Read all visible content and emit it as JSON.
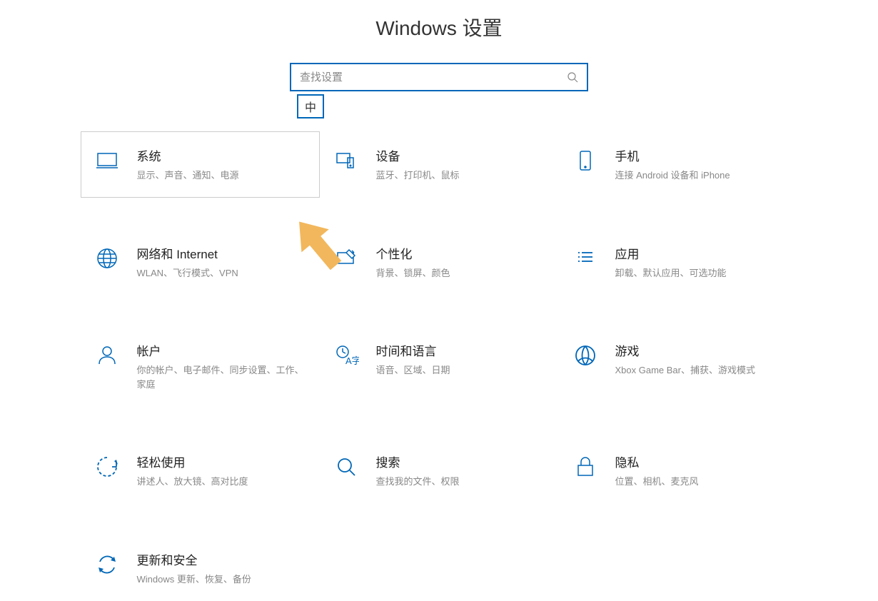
{
  "header": {
    "title": "Windows 设置"
  },
  "search": {
    "placeholder": "查找设置"
  },
  "ime": {
    "label": "中"
  },
  "settings": [
    {
      "id": "system",
      "title": "系统",
      "desc": "显示、声音、通知、电源",
      "highlighted": true
    },
    {
      "id": "devices",
      "title": "设备",
      "desc": "蓝牙、打印机、鼠标",
      "highlighted": false
    },
    {
      "id": "phone",
      "title": "手机",
      "desc": "连接 Android 设备和 iPhone",
      "highlighted": false
    },
    {
      "id": "network",
      "title": "网络和 Internet",
      "desc": "WLAN、飞行模式、VPN",
      "highlighted": false
    },
    {
      "id": "personalization",
      "title": "个性化",
      "desc": "背景、锁屏、颜色",
      "highlighted": false
    },
    {
      "id": "apps",
      "title": "应用",
      "desc": "卸载、默认应用、可选功能",
      "highlighted": false
    },
    {
      "id": "accounts",
      "title": "帐户",
      "desc": "你的帐户、电子邮件、同步设置、工作、家庭",
      "highlighted": false
    },
    {
      "id": "time",
      "title": "时间和语言",
      "desc": "语音、区域、日期",
      "highlighted": false
    },
    {
      "id": "gaming",
      "title": "游戏",
      "desc": "Xbox Game Bar、捕获、游戏模式",
      "highlighted": false
    },
    {
      "id": "ease",
      "title": "轻松使用",
      "desc": "讲述人、放大镜、高对比度",
      "highlighted": false
    },
    {
      "id": "search-cat",
      "title": "搜索",
      "desc": "查找我的文件、权限",
      "highlighted": false
    },
    {
      "id": "privacy",
      "title": "隐私",
      "desc": "位置、相机、麦克风",
      "highlighted": false
    },
    {
      "id": "update",
      "title": "更新和安全",
      "desc": "Windows 更新、恢复、备份",
      "highlighted": false
    }
  ]
}
